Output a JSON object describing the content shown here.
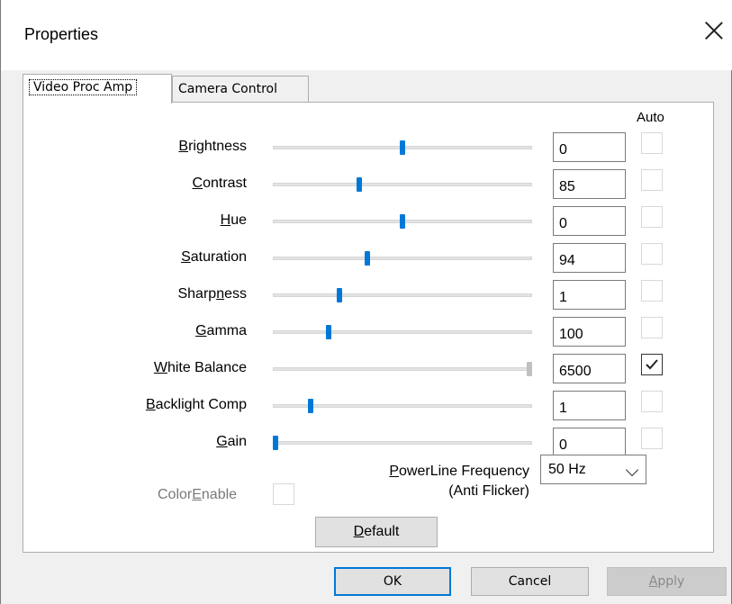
{
  "window": {
    "title": "Properties"
  },
  "tabs": [
    {
      "label": "Video Proc Amp",
      "active": true
    },
    {
      "label": "Camera Control",
      "active": false
    }
  ],
  "auto_header": "Auto",
  "rows": [
    {
      "label_pre": "",
      "label_key": "B",
      "label_post": "rightness",
      "value": "0",
      "fraction": 0.5,
      "auto": false,
      "disabled": false
    },
    {
      "label_pre": "",
      "label_key": "C",
      "label_post": "ontrast",
      "value": "85",
      "fraction": 0.33,
      "auto": false,
      "disabled": false
    },
    {
      "label_pre": "",
      "label_key": "H",
      "label_post": "ue",
      "value": "0",
      "fraction": 0.5,
      "auto": false,
      "disabled": false
    },
    {
      "label_pre": "",
      "label_key": "S",
      "label_post": "aturation",
      "value": "94",
      "fraction": 0.36,
      "auto": false,
      "disabled": false
    },
    {
      "label_pre": "Sharp",
      "label_key": "n",
      "label_post": "ess",
      "value": "1",
      "fraction": 0.25,
      "auto": false,
      "disabled": false
    },
    {
      "label_pre": "",
      "label_key": "G",
      "label_post": "amma",
      "value": "100",
      "fraction": 0.21,
      "auto": false,
      "disabled": false
    },
    {
      "label_pre": "",
      "label_key": "W",
      "label_post": "hite Balance",
      "value": "6500",
      "fraction": 1.0,
      "auto": true,
      "disabled": true
    },
    {
      "label_pre": "",
      "label_key": "B",
      "label_post": "acklight Comp",
      "value": "1",
      "fraction": 0.14,
      "auto": false,
      "disabled": false
    },
    {
      "label_pre": "",
      "label_key": "G",
      "label_post": "ain",
      "value": "0",
      "fraction": 0.0,
      "auto": false,
      "disabled": false
    }
  ],
  "color_enable": {
    "label_pre": "Color",
    "label_key": "E",
    "label_post": "nable",
    "checked": false
  },
  "powerline": {
    "label_pre": "",
    "label_key": "P",
    "label_post": "owerLine Frequency",
    "label_line2": "(Anti Flicker)",
    "selected": "50 Hz"
  },
  "buttons": {
    "default_pre": "",
    "default_key": "D",
    "default_post": "efault",
    "ok": "OK",
    "cancel": "Cancel",
    "apply_pre": "",
    "apply_key": "A",
    "apply_post": "pply"
  },
  "colors": {
    "accent": "#0078d7",
    "disabled_thumb": "#c0c0c0"
  },
  "icons": {
    "close": "close-icon",
    "checkmark": "checkmark-icon",
    "dropdown": "chevron-down-icon"
  }
}
